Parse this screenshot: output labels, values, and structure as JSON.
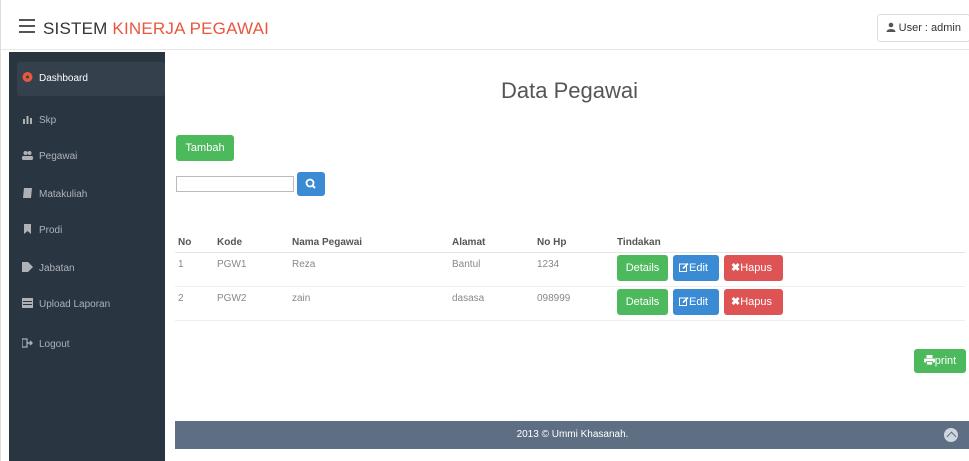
{
  "header": {
    "brand_prefix": "SISTEM ",
    "brand_accent": "KINERJA PEGAWAI",
    "user_label": "User : admin"
  },
  "sidebar": {
    "items": [
      {
        "label": "Dashboard",
        "icon": "dashboard-icon",
        "active": true
      },
      {
        "label": "Skp",
        "icon": "bar-chart-icon"
      },
      {
        "label": "Pegawai",
        "icon": "users-icon"
      },
      {
        "label": "Matakuliah",
        "icon": "book-icon"
      },
      {
        "label": "Prodi",
        "icon": "bookmark-icon"
      },
      {
        "label": "Jabatan",
        "icon": "tag-icon"
      },
      {
        "label": "Upload Laporan",
        "icon": "upload-icon"
      },
      {
        "label": "Logout",
        "icon": "logout-icon"
      }
    ]
  },
  "main": {
    "title": "Data Pegawai",
    "add_button": "Tambah",
    "search_placeholder": "",
    "table": {
      "headers": [
        "No",
        "Kode",
        "Nama Pegawai",
        "Alamat",
        "No Hp",
        "Tindakan"
      ],
      "rows": [
        {
          "no": "1",
          "kode": "PGW1",
          "nama": "Reza",
          "alamat": "Bantul",
          "hp": "1234"
        },
        {
          "no": "2",
          "kode": "PGW2",
          "nama": "zain",
          "alamat": "dasasa",
          "hp": "098999"
        }
      ],
      "actions": {
        "details": "Details",
        "edit": "Edit",
        "hapus": "Hapus"
      }
    },
    "print_button": "print"
  },
  "footer": {
    "text": "2013 © Ummi Khasanah."
  },
  "colors": {
    "accent": "#e9573f",
    "sidebar_bg": "#2a3542",
    "green": "#4cba5c",
    "blue": "#3b8bd4",
    "red": "#de5454",
    "footer_bg": "#5e6f83"
  }
}
